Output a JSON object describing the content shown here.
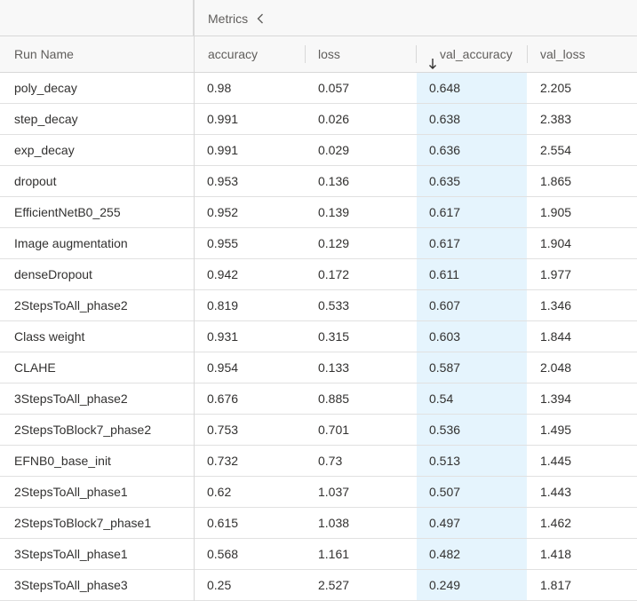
{
  "header": {
    "group_label": "Metrics",
    "collapse_icon": "chevron-left-icon",
    "columns": {
      "run_name": "Run Name",
      "accuracy": "accuracy",
      "loss": "loss",
      "val_accuracy": "val_accuracy",
      "val_loss": "val_loss"
    },
    "sort_icon": "arrow-down-icon",
    "sorted_column": "val_accuracy",
    "sort_direction": "descending"
  },
  "colors": {
    "sorted_column_bg": "#e5f4fd",
    "header_bg": "#f8f8f8",
    "border": "#d8d8d8"
  },
  "rows": [
    {
      "name": "poly_decay",
      "accuracy": "0.98",
      "loss": "0.057",
      "val_accuracy": "0.648",
      "val_loss": "2.205"
    },
    {
      "name": "step_decay",
      "accuracy": "0.991",
      "loss": "0.026",
      "val_accuracy": "0.638",
      "val_loss": "2.383"
    },
    {
      "name": "exp_decay",
      "accuracy": "0.991",
      "loss": "0.029",
      "val_accuracy": "0.636",
      "val_loss": "2.554"
    },
    {
      "name": "dropout",
      "accuracy": "0.953",
      "loss": "0.136",
      "val_accuracy": "0.635",
      "val_loss": "1.865"
    },
    {
      "name": "EfficientNetB0_255",
      "accuracy": "0.952",
      "loss": "0.139",
      "val_accuracy": "0.617",
      "val_loss": "1.905"
    },
    {
      "name": "Image augmentation",
      "accuracy": "0.955",
      "loss": "0.129",
      "val_accuracy": "0.617",
      "val_loss": "1.904"
    },
    {
      "name": "denseDropout",
      "accuracy": "0.942",
      "loss": "0.172",
      "val_accuracy": "0.611",
      "val_loss": "1.977"
    },
    {
      "name": "2StepsToAll_phase2",
      "accuracy": "0.819",
      "loss": "0.533",
      "val_accuracy": "0.607",
      "val_loss": "1.346"
    },
    {
      "name": "Class weight",
      "accuracy": "0.931",
      "loss": "0.315",
      "val_accuracy": "0.603",
      "val_loss": "1.844"
    },
    {
      "name": "CLAHE",
      "accuracy": "0.954",
      "loss": "0.133",
      "val_accuracy": "0.587",
      "val_loss": "2.048"
    },
    {
      "name": "3StepsToAll_phase2",
      "accuracy": "0.676",
      "loss": "0.885",
      "val_accuracy": "0.54",
      "val_loss": "1.394"
    },
    {
      "name": "2StepsToBlock7_phase2",
      "accuracy": "0.753",
      "loss": "0.701",
      "val_accuracy": "0.536",
      "val_loss": "1.495"
    },
    {
      "name": "EFNB0_base_init",
      "accuracy": "0.732",
      "loss": "0.73",
      "val_accuracy": "0.513",
      "val_loss": "1.445"
    },
    {
      "name": "2StepsToAll_phase1",
      "accuracy": "0.62",
      "loss": "1.037",
      "val_accuracy": "0.507",
      "val_loss": "1.443"
    },
    {
      "name": "2StepsToBlock7_phase1",
      "accuracy": "0.615",
      "loss": "1.038",
      "val_accuracy": "0.497",
      "val_loss": "1.462"
    },
    {
      "name": "3StepsToAll_phase1",
      "accuracy": "0.568",
      "loss": "1.161",
      "val_accuracy": "0.482",
      "val_loss": "1.418"
    },
    {
      "name": "3StepsToAll_phase3",
      "accuracy": "0.25",
      "loss": "2.527",
      "val_accuracy": "0.249",
      "val_loss": "1.817"
    }
  ]
}
